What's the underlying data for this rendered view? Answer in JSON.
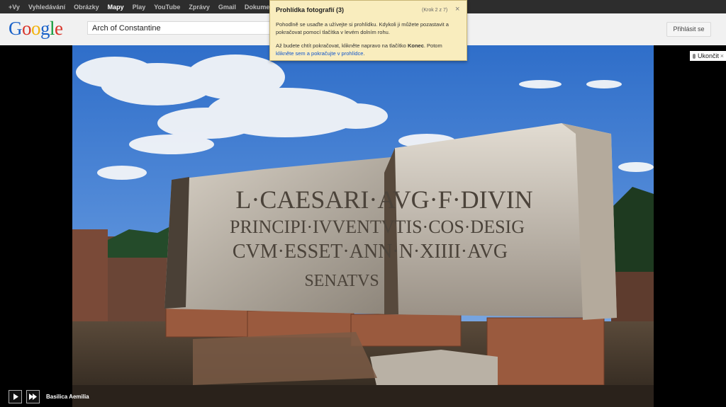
{
  "gbar": {
    "items": [
      {
        "label": "+Vy",
        "active": false
      },
      {
        "label": "Vyhledávání",
        "active": false
      },
      {
        "label": "Obrázky",
        "active": false
      },
      {
        "label": "Mapy",
        "active": true
      },
      {
        "label": "Play",
        "active": false
      },
      {
        "label": "YouTube",
        "active": false
      },
      {
        "label": "Zprávy",
        "active": false
      },
      {
        "label": "Gmail",
        "active": false
      },
      {
        "label": "Dokumenty",
        "active": false
      }
    ]
  },
  "header": {
    "logo": "Google",
    "search_value": "Arch of Constantine",
    "signin_label": "Přihlásit se"
  },
  "tour": {
    "title": "Prohlídka fotografií (3)",
    "step": "(Krok 2 z 7)",
    "close": "×",
    "para1": "Pohodlně se usaďte a užívejte si prohlídku. Kdykoli ji můžete pozastavit a pokračovat pomocí tlačítka v levém dolním rohu.",
    "para2_a": "Až budete chtít pokračovat, klikněte napravo na tlačítko ",
    "para2_b": "Konec",
    "para2_c": ". Potom ",
    "para2_link": "klikněte sem a pokračujte v prohlídce",
    "para2_d": "."
  },
  "exit": {
    "label": "Ukončit",
    "close": "×"
  },
  "photo": {
    "inscription": [
      "L·CAESARI·AVG·F·DIVIN",
      "PRINCIPI·IVVENTVTIS·COS·DESIG",
      "CVM·ESSET·ANN·N·XIIII·AVG",
      "SENATVS"
    ]
  },
  "footer": {
    "caption": "Basilica Aemilia"
  }
}
